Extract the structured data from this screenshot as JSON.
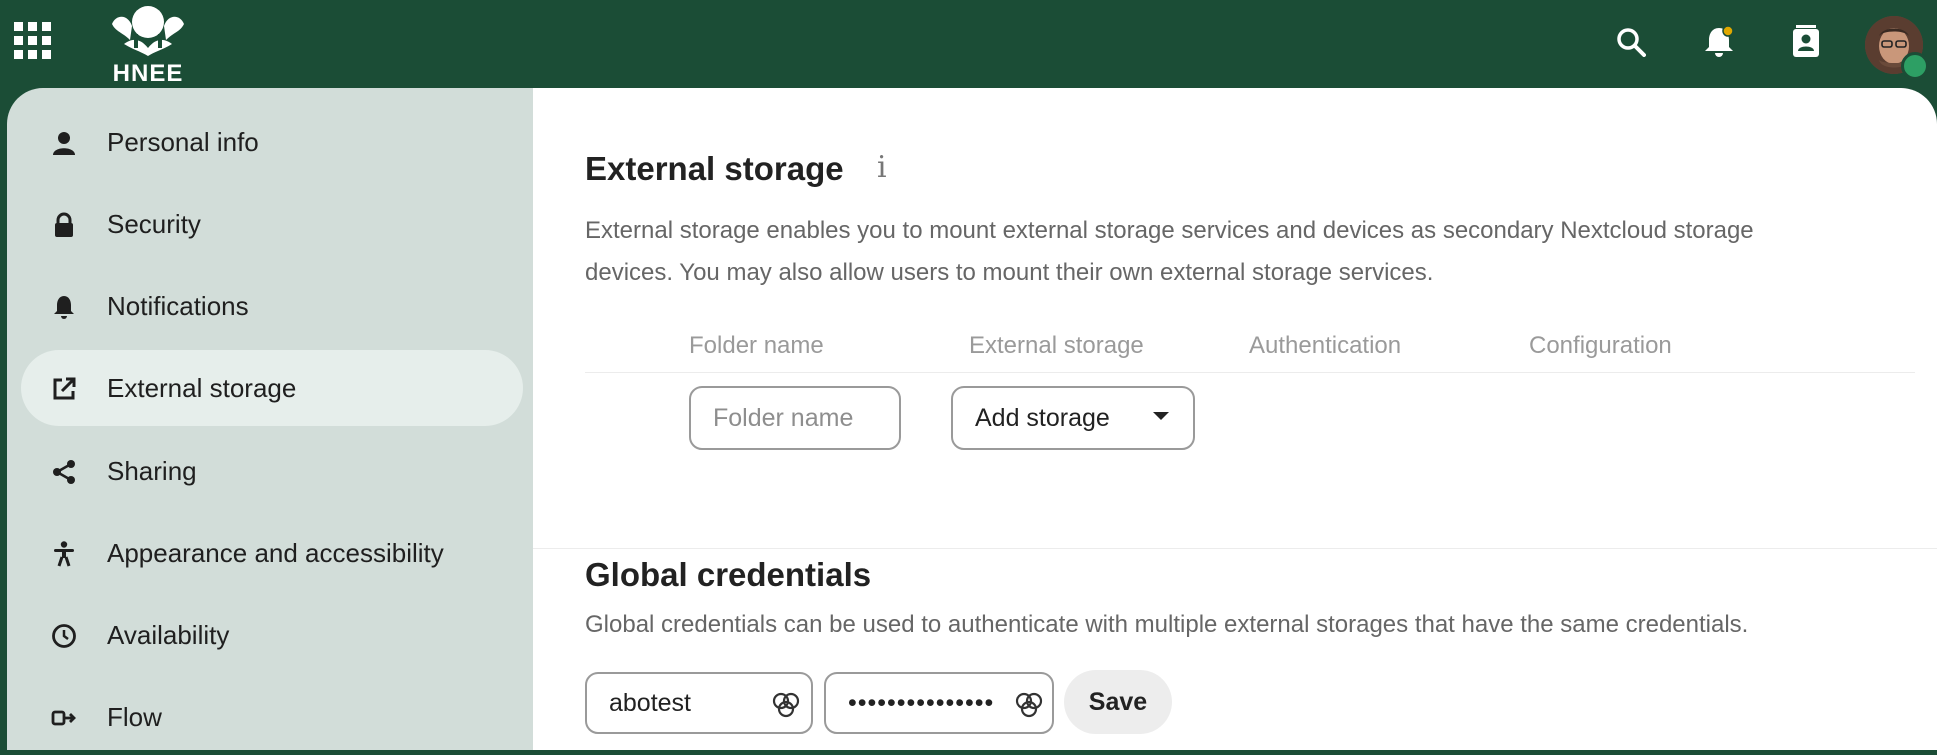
{
  "header": {
    "logo_text": "HNEE",
    "icons": [
      "apps-icon",
      "search-icon",
      "bell-icon",
      "contacts-icon"
    ],
    "notification_dot_color": "#e0a800",
    "status_color": "#2d9f64"
  },
  "sidebar": {
    "items": [
      {
        "label": "Personal info",
        "icon": "person-icon"
      },
      {
        "label": "Security",
        "icon": "lock-icon"
      },
      {
        "label": "Notifications",
        "icon": "bell-icon"
      },
      {
        "label": "External storage",
        "icon": "open-in-new-icon",
        "active": true
      },
      {
        "label": "Sharing",
        "icon": "share-icon"
      },
      {
        "label": "Appearance and accessibility",
        "icon": "accessibility-icon"
      },
      {
        "label": "Availability",
        "icon": "clock-icon"
      },
      {
        "label": "Flow",
        "icon": "flow-icon"
      }
    ]
  },
  "external_storage": {
    "title": "External storage",
    "info_glyph": "i",
    "description_line1": "External storage enables you to mount external storage services and devices as secondary Nextcloud storage",
    "description_line2": "devices. You may also allow users to mount their own external storage services.",
    "columns": [
      "Folder name",
      "External storage",
      "Authentication",
      "Configuration"
    ],
    "folder_placeholder": "Folder name",
    "add_storage_label": "Add storage"
  },
  "global_credentials": {
    "title": "Global credentials",
    "description": "Global credentials can be used to authenticate with multiple external storages that have the same credentials.",
    "username_value": "abotest",
    "password_value": "•••••••••••••••",
    "save_label": "Save"
  },
  "colors": {
    "brand": "#1b4d36",
    "sidebar_bg": "#d2ddd9",
    "active_item_bg": "#e6eeeb"
  }
}
